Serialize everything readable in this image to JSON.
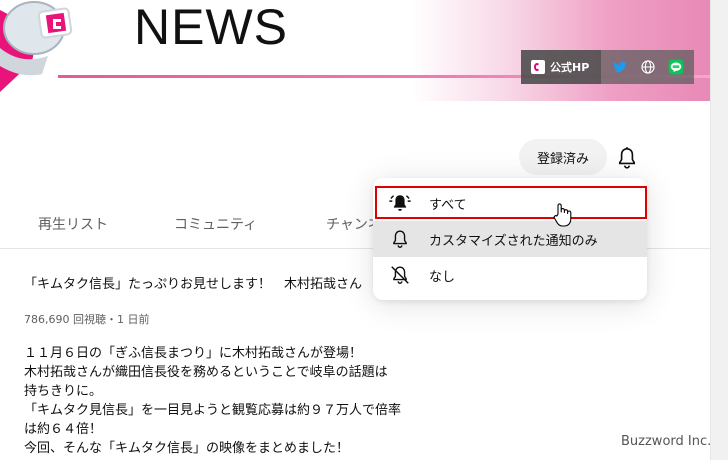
{
  "banner": {
    "title": "NEWS",
    "hp_link": "公式HP"
  },
  "channel": {
    "subscribed_label": "登録済み"
  },
  "tabs": [
    {
      "label": "再生リスト"
    },
    {
      "label": "コミュニティ"
    },
    {
      "label": "チャンネル"
    }
  ],
  "video": {
    "title": "「キムタク信長」たっぷりお見せします！　木村拓哉さん",
    "meta": "786,690 回視聴・1 日前",
    "description": [
      "１１月６日の「ぎふ信長まつり」に木村拓哉さんが登場！",
      "木村拓哉さんが織田信長役を務めるということで岐阜の話題は",
      "持ちきりに。",
      "「キムタク見信長」を一目見ようと観覧応募は約９７万人で倍率",
      "は約６４倍！",
      "今回、そんな「キムタク信長」の映像をまとめました！"
    ]
  },
  "notification_menu": {
    "items": [
      {
        "label": "すべて",
        "icon": "bell-ringing-icon"
      },
      {
        "label": "カスタマイズされた通知のみ",
        "icon": "bell-outline-icon"
      },
      {
        "label": "なし",
        "icon": "bell-off-icon"
      }
    ]
  },
  "watermark": "Buzzword Inc."
}
